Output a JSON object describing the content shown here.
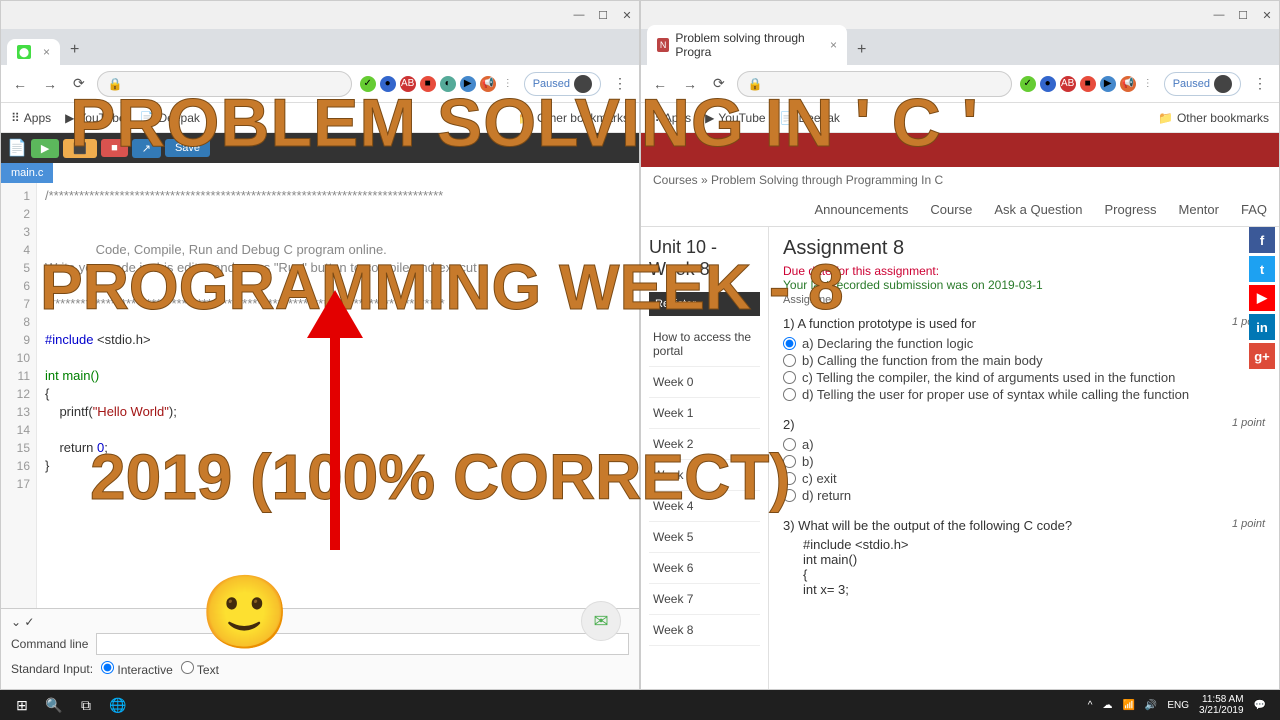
{
  "left": {
    "tab_title": "",
    "paused": "Paused",
    "bookmarks": {
      "apps": "Apps",
      "youtube": "YouTube",
      "deepak": "Deepak",
      "other": "Other bookmarks"
    },
    "ide": {
      "save": "Save",
      "filetab": "main.c"
    },
    "code": {
      "lines": [
        "1",
        "2",
        "3",
        "4",
        "5",
        "6",
        "7",
        "8",
        "9",
        "10",
        "11",
        "12",
        "13",
        "14",
        "15",
        "16",
        "17"
      ],
      "l4": "              Code, Compile, Run and Debug C program online.",
      "l5": "Write your code in this editor and press \"Run\" button to compile and execut",
      "l7": "*******************************************************************************",
      "l9a": "#include",
      "l9b": " <stdio.h>",
      "l11": "int main()",
      "l12": "{",
      "l13a": "    printf(",
      "l13b": "\"Hello World\"",
      "l13c": ");",
      "l15a": "    return ",
      "l15b": "0",
      "l15c": ";",
      "l16": "}"
    },
    "panel": {
      "cmdline": "Command line",
      "stdin": "Standard Input:",
      "inter": "Interactive",
      "text": "Text"
    }
  },
  "right": {
    "tab_title": "Problem solving through Progra",
    "paused": "Paused",
    "bookmarks": {
      "apps": "Apps",
      "youtube": "YouTube",
      "deepak": "Deepak",
      "other": "Other bookmarks"
    },
    "breadcrumb": "Courses  »  Problem Solving through Programming In C",
    "nav": {
      "announce": "Announcements",
      "course": "Course",
      "ask": "Ask a Question",
      "progress": "Progress",
      "mentor": "Mentor",
      "faq": "FAQ"
    },
    "unit": "Unit 10 - Week 8",
    "side": {
      "access": "How to access the portal",
      "w0": "Week 0",
      "w1": "Week 1",
      "w2": "Week 2",
      "w3": "Week 3",
      "w4": "Week 4",
      "w5": "Week 5",
      "w6": "Week 6",
      "w7": "Week 7",
      "w8": "Week 8"
    },
    "assign": {
      "title": "Assignment 8",
      "due": "Due date for this assignment:",
      "submit": "Your last recorded submission was on 2019-03-1",
      "sub": "Assignment"
    },
    "q1": {
      "text": "1) A function prototype is used for",
      "pts": "1 point",
      "a": "a)  Declaring the function logic",
      "b": "b)  Calling the function from the main body",
      "c": "c)  Telling the compiler, the kind of arguments used in the function",
      "d": "d)  Telling the user for proper use of syntax while calling the function"
    },
    "q2": {
      "text": "2) ",
      "a": "a)",
      "b": "b)",
      "c": "c)  exit",
      "d": "d)  return",
      "pts": "1 point"
    },
    "q3": {
      "text": "3)  What will be the output of the following C code?",
      "pts": "1 point",
      "c1": "#include <stdio.h>",
      "c2": "int main()",
      "c3": "{",
      "c4": "int x= 3;"
    }
  },
  "overlay": {
    "l1": "PROBLEM SOLVING IN ' C '",
    "l2": "PROGRAMMING   WEEK - 8",
    "l3": "2019    (100% CORRECT)",
    "emoji": "🙂"
  },
  "taskbar": {
    "lang": "ENG",
    "time": "11:58 AM",
    "date": "3/21/2019"
  }
}
